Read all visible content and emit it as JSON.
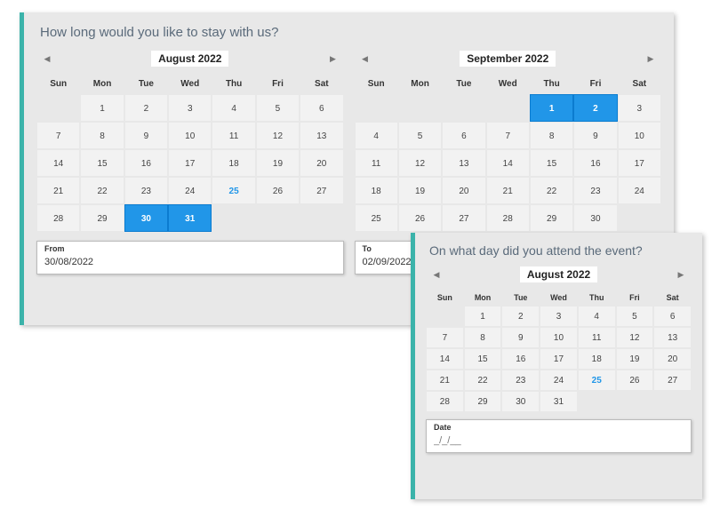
{
  "questions": {
    "range": "How long would you like to stay with us?",
    "single": "On what day did you attend the event?"
  },
  "daysOfWeek": [
    "Sun",
    "Mon",
    "Tue",
    "Wed",
    "Thu",
    "Fri",
    "Sat"
  ],
  "calendars": {
    "left": {
      "title": "August 2022",
      "startOffset": 1,
      "numDays": 31,
      "today": 25,
      "selectedFrom": 30,
      "selectedTo": 31
    },
    "right": {
      "title": "September 2022",
      "startOffset": 4,
      "numDays": 30,
      "today": null,
      "selectedFrom": 1,
      "selectedTo": 2
    },
    "single": {
      "title": "August 2022",
      "startOffset": 1,
      "numDays": 31,
      "today": 25,
      "selectedFrom": null,
      "selectedTo": null
    }
  },
  "fields": {
    "fromLabel": "From",
    "fromValue": "30/08/2022",
    "toLabel": "To",
    "toValue": "02/09/2022",
    "dateLabel": "Date",
    "dateValue": "",
    "datePlaceholder": "_/_/__"
  }
}
